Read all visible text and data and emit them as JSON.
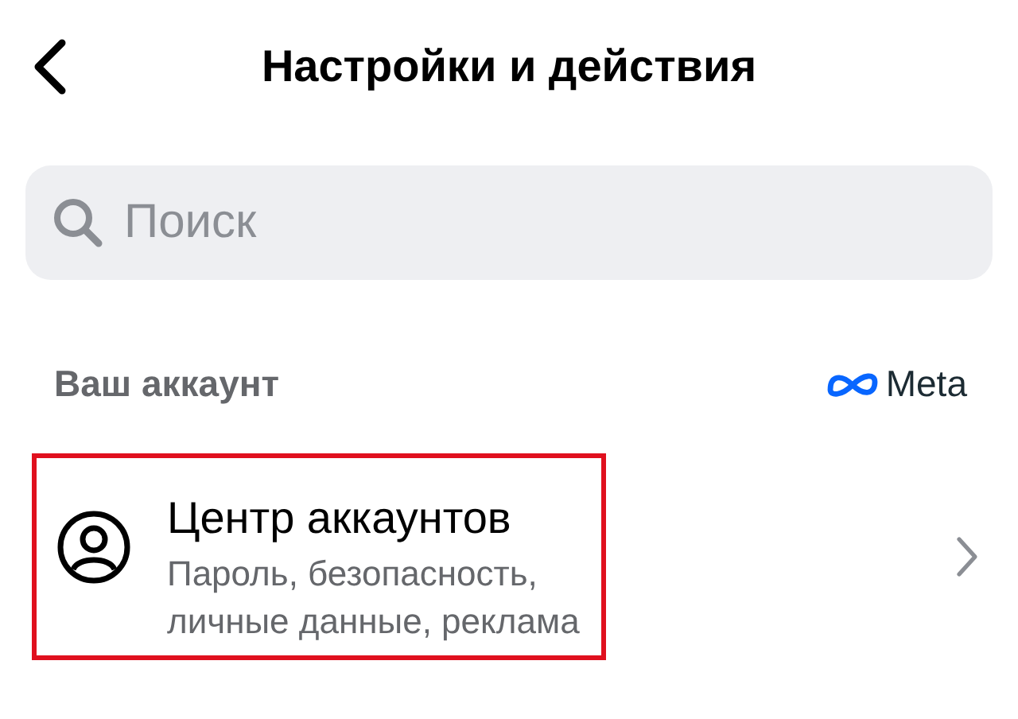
{
  "header": {
    "title": "Настройки и действия"
  },
  "search": {
    "placeholder": "Поиск"
  },
  "section": {
    "title": "Ваш аккаунт",
    "brand": "Meta"
  },
  "items": [
    {
      "title": "Центр аккаунтов",
      "subtitle": "Пароль, безопасность,\nличные данные, реклама",
      "highlighted": true
    }
  ]
}
